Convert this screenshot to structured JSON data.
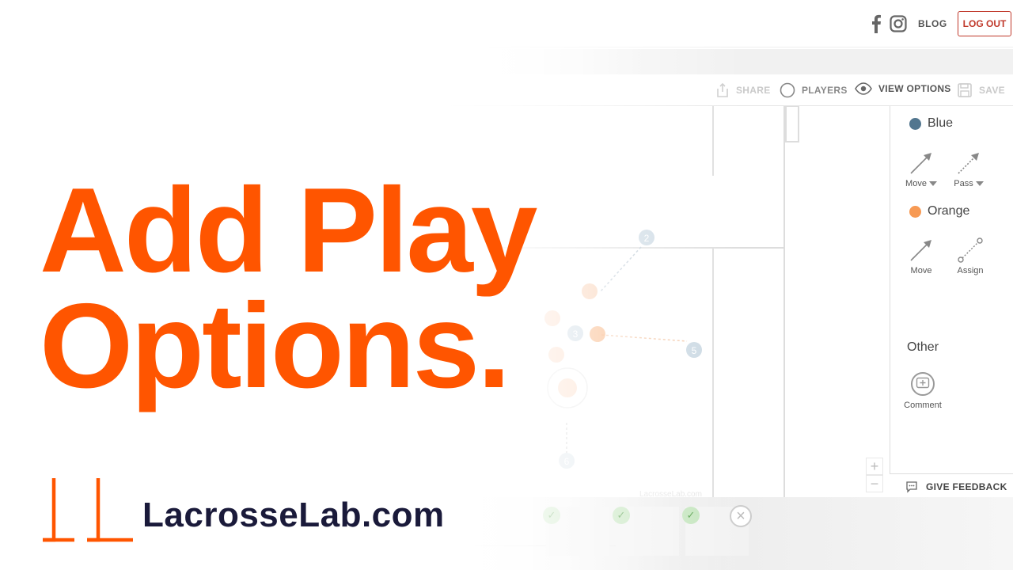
{
  "topbar": {
    "facebook_icon": "facebook-icon",
    "instagram_icon": "instagram-icon",
    "blog_label": "BLOG",
    "logout_label": "LOG OUT"
  },
  "toolbar": {
    "share_label": "SHARE",
    "players_label": "PLAYERS",
    "view_options_label": "VIEW OPTIONS",
    "save_label": "SAVE"
  },
  "panel": {
    "blue": {
      "label": "Blue",
      "color": "#52768f",
      "tools": [
        {
          "label": "Move"
        },
        {
          "label": "Pass"
        }
      ]
    },
    "orange": {
      "label": "Orange",
      "color": "#f79a54",
      "tools": [
        {
          "label": "Move"
        },
        {
          "label": "Assign"
        }
      ]
    },
    "other": {
      "label": "Other",
      "tools": [
        {
          "label": "Comment"
        }
      ]
    },
    "feedback_label": "GIVE FEEDBACK"
  },
  "field": {
    "players": [
      "2",
      "3",
      "5",
      "6"
    ],
    "watermark": "LacrosseLab.com"
  },
  "headline": {
    "line1": "Add Play",
    "line2": "Options."
  },
  "brand": {
    "name": "LacrosseLab.com",
    "accent": "#ff5500"
  }
}
